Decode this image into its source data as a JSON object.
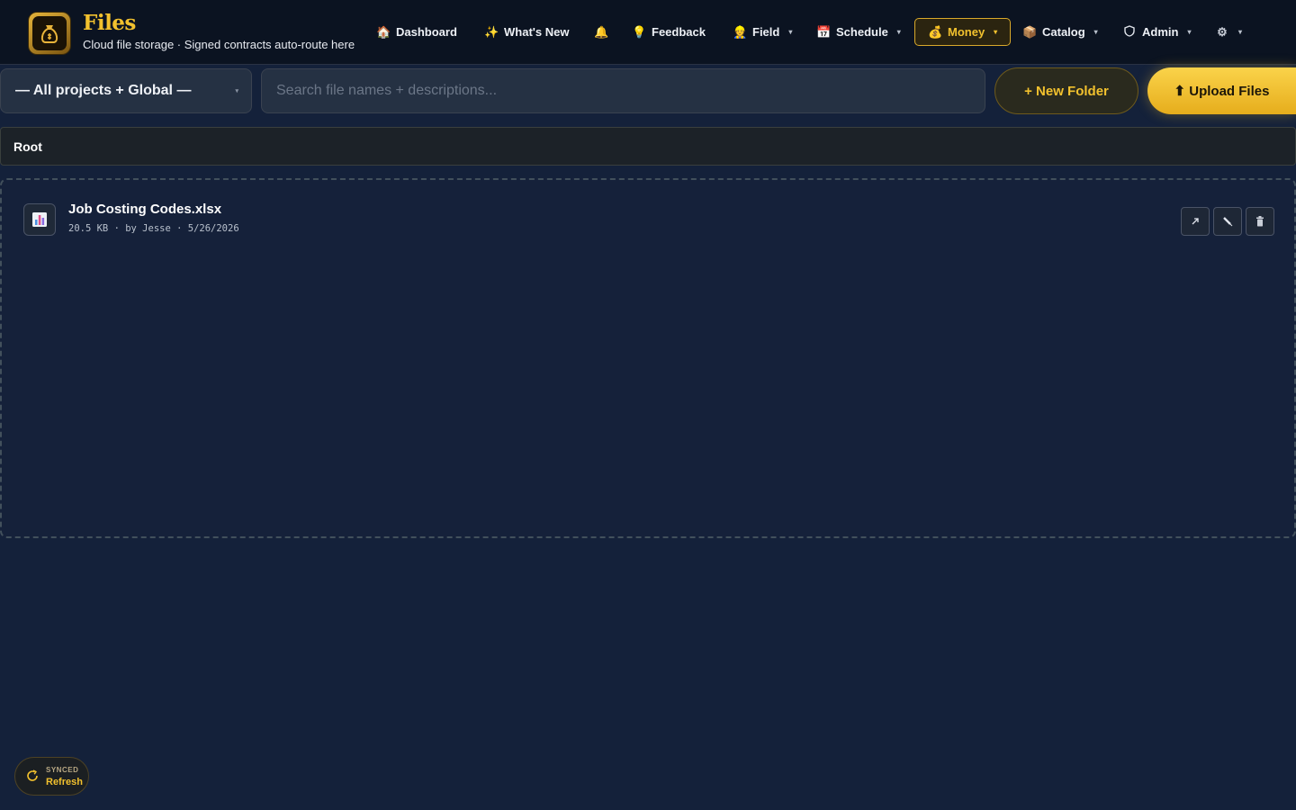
{
  "header": {
    "title": "Files",
    "subtitle": "Cloud file storage · Signed contracts auto-route here"
  },
  "nav": {
    "dashboard": {
      "icon": "house-icon",
      "label": "Dashboard"
    },
    "whats_new": {
      "icon": "sparkle-icon",
      "label": "What's New"
    },
    "notifications": {
      "icon": "bell-icon"
    },
    "feedback": {
      "icon": "lightbulb-icon",
      "label": "Feedback"
    },
    "field": {
      "icon": "worker-icon",
      "label": "Field"
    },
    "schedule": {
      "icon": "calendar-icon",
      "label": "Schedule"
    },
    "money": {
      "icon": "money-bag-icon",
      "label": "Money",
      "active": true
    },
    "catalog": {
      "icon": "package-icon",
      "label": "Catalog"
    },
    "admin": {
      "icon": "shield-icon",
      "label": "Admin"
    },
    "settings": {
      "icon": "gear-icon"
    }
  },
  "toolbar": {
    "project_filter": "— All projects + Global —",
    "search_placeholder": "Search file names + descriptions...",
    "new_folder_label": "+ New Folder",
    "upload_label": "⬆ Upload Files"
  },
  "breadcrumb": {
    "root": "Root"
  },
  "files": [
    {
      "name": "Job Costing Codes.xlsx",
      "icon": "spreadsheet-icon",
      "meta": "20.5 KB · by Jesse · 5/26/2026",
      "actions": [
        "open-icon",
        "edit-icon",
        "trash-icon"
      ]
    }
  ],
  "sync": {
    "status": "SYNCED",
    "label": "Refresh"
  },
  "colors": {
    "accent": "#f2c12e",
    "background": "#14213a",
    "header": "#0b1321"
  }
}
